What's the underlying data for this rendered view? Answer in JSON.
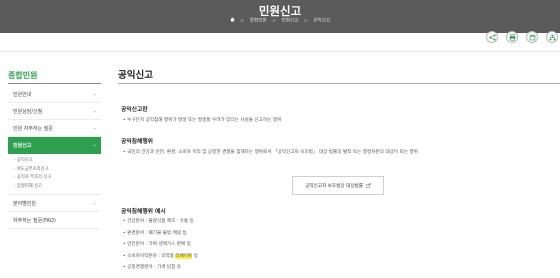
{
  "header": {
    "title": "민원신고",
    "breadcrumb": [
      "종합민원",
      "민원신고",
      "공익신고"
    ]
  },
  "tools": [
    {
      "icon": "share-icon"
    },
    {
      "icon": "print-icon"
    },
    {
      "icon": "bookmark-icon"
    },
    {
      "icon": "sitemap-icon"
    }
  ],
  "sidebar": {
    "title": "종합민원",
    "items": [
      {
        "label": "민원안내"
      },
      {
        "label": "민원상담/신청"
      },
      {
        "label": "민원 자주하는 질문"
      },
      {
        "label": "민원신고"
      }
    ],
    "subitems": [
      "- 공익신고",
      "- 위도급부조리신고",
      "- 공직자 부조리 신고",
      "- 갑질피해 신고"
    ],
    "after": [
      {
        "label": "분야별민원"
      },
      {
        "label": "자주하는 질문(FAQ)"
      }
    ]
  },
  "content": {
    "title": "공익신고",
    "sections": [
      {
        "heading": "공익신고란",
        "body": "• 누구든지 공익침해 행위가 발생 또는 발생할 우려가 있다는 사실을 신고하는 행위"
      },
      {
        "heading": "공익침해행위",
        "body": "• 국민의 건강과 안전, 환경, 소비자 이익 및 공정한 경쟁을 침해하는 행위로서 「공익신고자 보호법」 대상 법률의 벌칙 또는 행정처분의 대상이 되는 행위"
      }
    ],
    "law_button": "공익신고자 보호법상 대상법률",
    "examples_heading": "공익침해행위 예시",
    "examples": [
      {
        "label": "건강분야 : 불량식품 제조 · 유통 등"
      },
      {
        "label": "환경분야 : 폐기물 불법 매립 등"
      },
      {
        "label": "안전분야 : 가짜 냉매가스 판매 등"
      },
      {
        "label": "소비자이익분야 : 의약품 ",
        "highlight": "리베이트",
        "suffix": " 등"
      },
      {
        "label": "공정경쟁분야 : 가격 담합 등"
      }
    ]
  }
}
